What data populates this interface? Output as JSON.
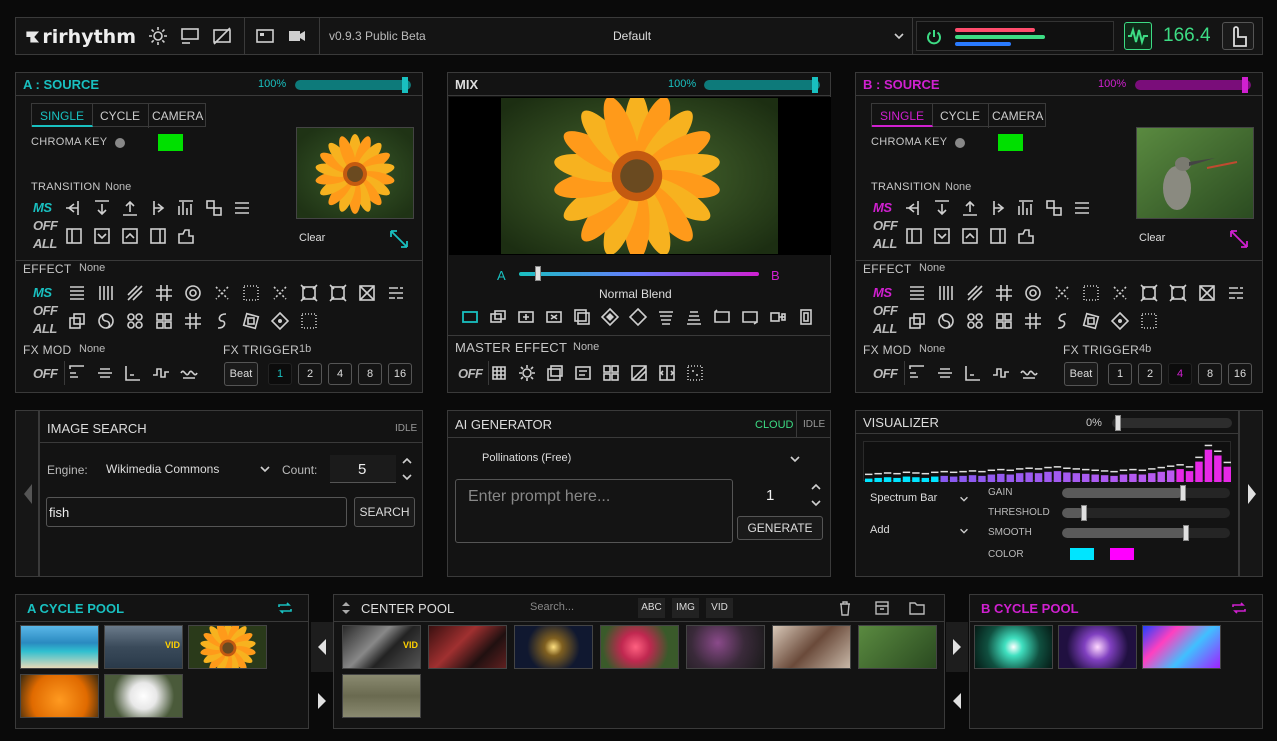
{
  "header": {
    "logo": "rirhythm",
    "version": "v0.9.3 Public Beta",
    "preset": "Default",
    "bpm": "166.4",
    "colors": {
      "bpm": "#3ddc84",
      "level_a": "#ff4d6d",
      "level_mid": "#3ddc84",
      "level_b": "#2a7bff"
    }
  },
  "source_a": {
    "title": "A : SOURCE",
    "opacity": "100%",
    "opacity_fraction": 1.0,
    "accent": "#19b9b9",
    "tabs": [
      "SINGLE",
      "CYCLE",
      "CAMERA"
    ],
    "chroma_key_label": "CHROMA KEY",
    "chroma_color": "#00e000",
    "transition_label": "TRANSITION",
    "transition_value": "None",
    "clear_label": "Clear",
    "effect_label": "EFFECT",
    "effect_value": "None",
    "fxmod_label": "FX MOD",
    "fxmod_value": "None",
    "fxtrigger_label": "FX TRIGGER",
    "fxtrigger_value": "1b",
    "beat_label": "Beat",
    "trigger_nums": [
      "1",
      "2",
      "4",
      "8",
      "16"
    ],
    "trigger_active": "1",
    "ms": "MS",
    "off": "OFF",
    "all": "ALL"
  },
  "mix": {
    "title": "MIX",
    "opacity": "100%",
    "opacity_fraction": 1.0,
    "a_label": "A",
    "b_label": "B",
    "crossfade": 0.08,
    "blend_mode": "Normal Blend",
    "master_effect_label": "MASTER EFFECT",
    "master_effect_value": "None",
    "off": "OFF"
  },
  "source_b": {
    "title": "B : SOURCE",
    "opacity": "100%",
    "opacity_fraction": 1.0,
    "accent": "#d020d0",
    "tabs": [
      "SINGLE",
      "CYCLE",
      "CAMERA"
    ],
    "chroma_key_label": "CHROMA KEY",
    "chroma_color": "#00e000",
    "transition_label": "TRANSITION",
    "transition_value": "None",
    "clear_label": "Clear",
    "effect_label": "EFFECT",
    "effect_value": "None",
    "fxmod_label": "FX MOD",
    "fxmod_value": "None",
    "fxtrigger_label": "FX TRIGGER",
    "fxtrigger_value": "4b",
    "beat_label": "Beat",
    "trigger_nums": [
      "1",
      "2",
      "4",
      "8",
      "16"
    ],
    "trigger_active": "4",
    "ms": "MS",
    "off": "OFF",
    "all": "ALL"
  },
  "image_search": {
    "title": "IMAGE SEARCH",
    "status": "IDLE",
    "engine_label": "Engine:",
    "engine_value": "Wikimedia Commons",
    "count_label": "Count:",
    "count_value": "5",
    "query": "fish",
    "search_button": "SEARCH"
  },
  "ai_generator": {
    "title": "AI GENERATOR",
    "mode": "CLOUD",
    "status": "IDLE",
    "provider": "Pollinations (Free)",
    "prompt_placeholder": "Enter prompt here...",
    "count": "1",
    "generate_button": "GENERATE"
  },
  "visualizer": {
    "title": "VISUALIZER",
    "level": "0%",
    "mode": "Spectrum Bar",
    "blend": "Add",
    "gain_label": "GAIN",
    "gain": 0.72,
    "threshold_label": "THRESHOLD",
    "threshold": 0.13,
    "smooth_label": "SMOOTH",
    "smooth": 0.74,
    "color_label": "COLOR",
    "color1": "#00e5ff",
    "color2": "#ff00ff",
    "spectrum": [
      0.1,
      0.12,
      0.14,
      0.12,
      0.16,
      0.14,
      0.12,
      0.16,
      0.18,
      0.16,
      0.18,
      0.2,
      0.18,
      0.22,
      0.24,
      0.22,
      0.26,
      0.28,
      0.26,
      0.3,
      0.32,
      0.28,
      0.26,
      0.24,
      0.22,
      0.2,
      0.18,
      0.22,
      0.24,
      0.22,
      0.26,
      0.3,
      0.34,
      0.38,
      0.32,
      0.6,
      0.95,
      0.78,
      0.45
    ]
  },
  "pools": {
    "a_title": "A CYCLE POOL",
    "center_title": "CENTER POOL",
    "search_placeholder": "Search...",
    "filters": [
      "ABC",
      "IMG",
      "VID"
    ],
    "b_title": "B CYCLE POOL",
    "vid_badge": "VID"
  }
}
